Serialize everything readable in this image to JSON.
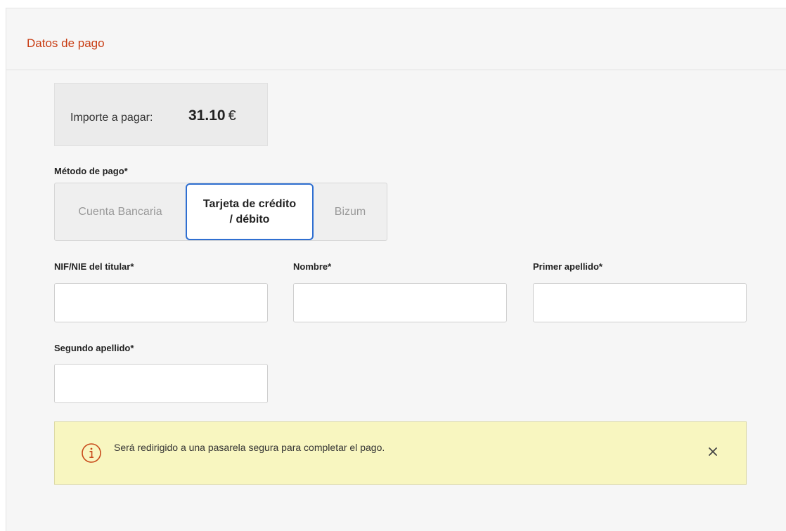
{
  "panel": {
    "title": "Datos de pago"
  },
  "amount": {
    "label": "Importe a pagar:",
    "value": "31.10",
    "currency": "€"
  },
  "payment_method": {
    "label": "Método de pago*",
    "options": [
      {
        "line1": "Cuenta Bancaria",
        "line2": ""
      },
      {
        "line1": "Tarjeta de crédito",
        "line2": "/ débito"
      },
      {
        "line1": "Bizum",
        "line2": ""
      }
    ],
    "selected": "Tarjeta de crédito / débito"
  },
  "fields": {
    "nif_label": "NIF/NIE del titular*",
    "nif_value": "",
    "nombre_label": "Nombre*",
    "nombre_value": "",
    "primer_apellido_label": "Primer apellido*",
    "primer_apellido_value": "",
    "segundo_apellido_label": "Segundo apellido*",
    "segundo_apellido_value": ""
  },
  "alert": {
    "text": "Será redirigido a una pasarela segura para completar el pago.",
    "icon": "info-circle-icon",
    "close_icon": "close-icon"
  },
  "colors": {
    "title": "#c83c12",
    "selected_border": "#2f6fd1",
    "alert_bg": "#f8f6c0",
    "alert_icon": "#c84a1a"
  }
}
